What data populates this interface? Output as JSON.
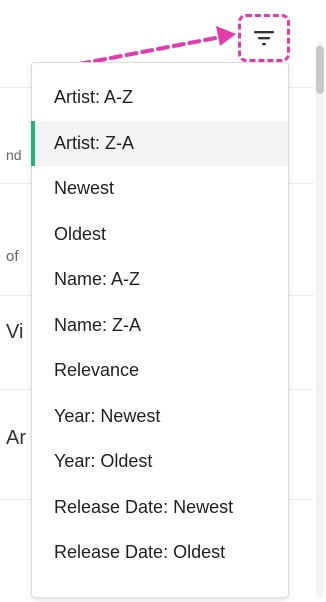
{
  "background_rows": [
    {
      "text": ""
    },
    {
      "text": "nd"
    },
    {
      "text": "of"
    },
    {
      "text": "Vi"
    },
    {
      "text": "Ar"
    },
    {
      "text": ""
    }
  ],
  "filter_button": {
    "icon": "filter-icon"
  },
  "sort_menu": {
    "items": [
      {
        "label": "Artist: A-Z"
      },
      {
        "label": "Artist: Z-A",
        "selected": true
      },
      {
        "label": "Newest"
      },
      {
        "label": "Oldest"
      },
      {
        "label": "Name: A-Z"
      },
      {
        "label": "Name: Z-A"
      },
      {
        "label": "Relevance"
      },
      {
        "label": "Year: Newest"
      },
      {
        "label": "Year: Oldest"
      },
      {
        "label": "Release Date: Newest"
      },
      {
        "label": "Release Date: Oldest"
      }
    ]
  },
  "colors": {
    "annotation": "#e33bb0",
    "selected_indicator": "#29b07a"
  }
}
